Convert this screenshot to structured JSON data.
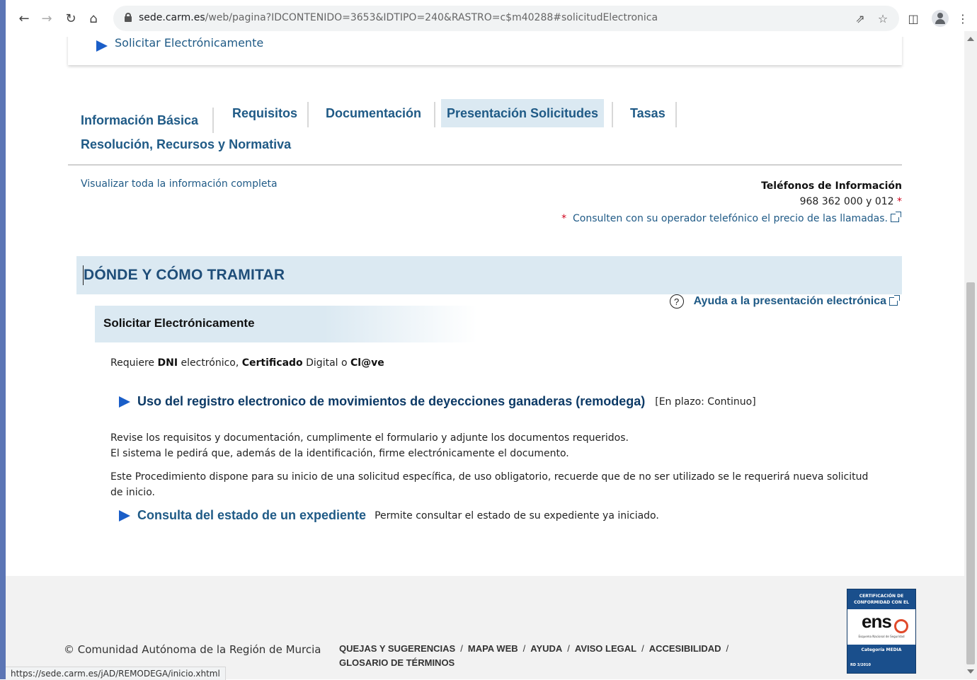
{
  "browser": {
    "url_host": "sede.carm.es",
    "url_path": "/web/pagina?IDCONTENIDO=3653&IDTIPO=240&RASTRO=c$m40288#solicitudElectronica",
    "status_url": "https://sede.carm.es/jAD/REMODEGA/inicio.xhtml",
    "icons": [
      "back-arrow-icon",
      "forward-arrow-icon",
      "reload-icon",
      "home-icon",
      "lock-icon",
      "share-icon",
      "star-icon",
      "side-panel-icon",
      "profile-icon",
      "kebab-menu-icon"
    ]
  },
  "top_card": {
    "link": "Solicitar Electrónicamente"
  },
  "tabs": [
    {
      "label": "Información Básica",
      "active": false
    },
    {
      "label": "Requisitos",
      "active": false
    },
    {
      "label": "Documentación",
      "active": false
    },
    {
      "label": "Presentación Solicitudes",
      "active": true
    },
    {
      "label": "Tasas",
      "active": false
    },
    {
      "label": "Resolución, Recursos y Normativa",
      "active": false
    }
  ],
  "info": {
    "view_all": "Visualizar toda la información completa",
    "phones_title": "Teléfonos de Información",
    "phones_number": "968 362 000 y 012",
    "star": "*",
    "phones_note": "Consulten con su operador telefónico el precio de las llamadas."
  },
  "section": {
    "title": "DÓNDE Y CÓMO TRAMITAR",
    "help_link": "Ayuda a la presentación electrónica",
    "sub_title": "Solicitar Electrónicamente",
    "requires": {
      "prefix": "Requiere",
      "dni": "DNI",
      "mid1": "electrónico,",
      "cert": "Certificado",
      "mid2": "Digital o",
      "clave": "Cl@ve"
    },
    "procedure_link": "Uso del registro electronico de movimientos de deyecciones ganaderas (remodega)",
    "procedure_status": "[En plazo: Continuo]",
    "paragraph1_line1": "Revise los requisitos y documentación, cumplimente el formulario y adjunte los documentos requeridos.",
    "paragraph1_line2": "El sistema le pedirá que, además de la identificación, firme electrónicamente el documento.",
    "paragraph2": "Este Procedimiento dispone para su inicio de una solicitud específica, de uso obligatorio, recuerde que de no ser utilizado se le requerirá nueva solicitud de inicio.",
    "consult_link": "Consulta del estado de un expediente",
    "consult_desc": "Permite consultar el estado de su expediente ya iniciado."
  },
  "footer": {
    "copyright": "© Comunidad Autónoma de la Región de Murcia",
    "links": [
      "QUEJAS Y SUGERENCIAS",
      "MAPA WEB",
      "AYUDA",
      "AVISO LEGAL",
      "ACCESIBILIDAD",
      "GLOSARIO DE TÉRMINOS"
    ],
    "separator": "/",
    "cert": {
      "top": "CERTIFICACIÓN DE CONFORMIDAD CON EL",
      "logo": "ens",
      "sub": "Esquema Nacional de Seguridad",
      "category": "Categoría MEDIA",
      "rd": "RD 3/2010"
    }
  },
  "colors": {
    "link": "#1f5a86",
    "tab_active_bg": "#dbe9f2",
    "arrow": "#1a5ec8",
    "footer_bg": "#f2f2f2"
  }
}
